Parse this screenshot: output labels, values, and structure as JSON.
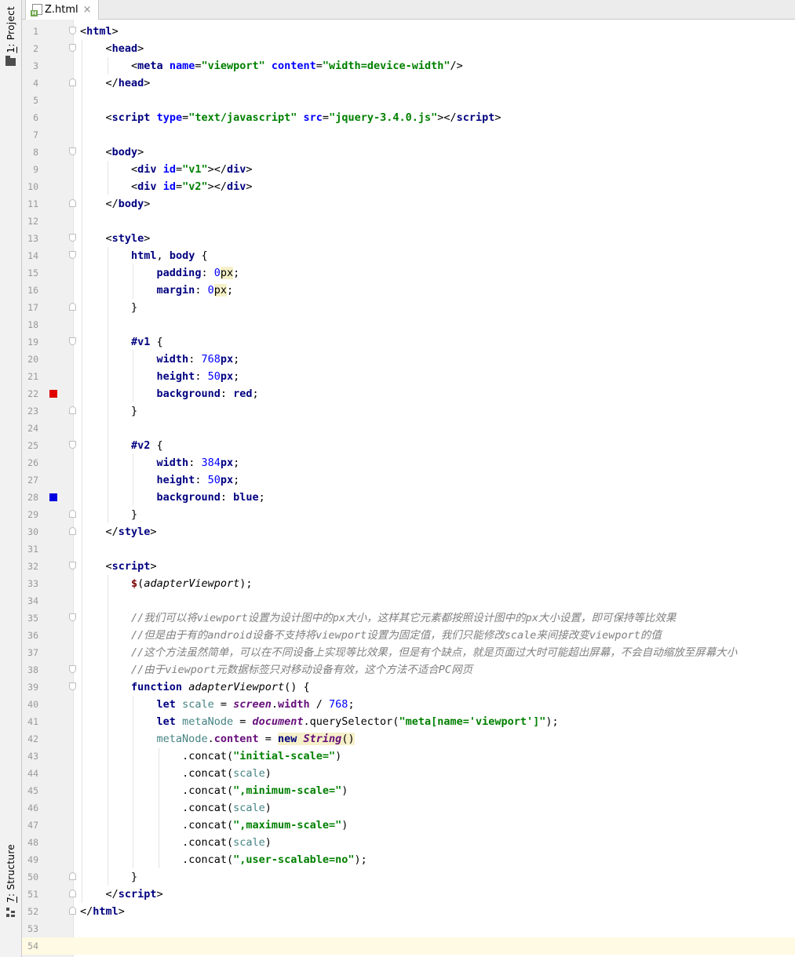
{
  "tool_window": {
    "project_label_num": "1",
    "project_label_text": ": Project",
    "structure_label_num": "7",
    "structure_label_text": ": Structure"
  },
  "editor_tab": {
    "filename": "Z.html",
    "icon_badge": "H",
    "close_glyph": "×"
  },
  "markers": {
    "line_22_color": "#e00000",
    "line_28_color": "#0000e0"
  },
  "lines": [
    {
      "n": "1"
    },
    {
      "n": "2"
    },
    {
      "n": "3"
    },
    {
      "n": "4"
    },
    {
      "n": "5"
    },
    {
      "n": "6"
    },
    {
      "n": "7"
    },
    {
      "n": "8"
    },
    {
      "n": "9"
    },
    {
      "n": "10"
    },
    {
      "n": "11"
    },
    {
      "n": "12"
    },
    {
      "n": "13"
    },
    {
      "n": "14"
    },
    {
      "n": "15"
    },
    {
      "n": "16"
    },
    {
      "n": "17"
    },
    {
      "n": "18"
    },
    {
      "n": "19"
    },
    {
      "n": "20"
    },
    {
      "n": "21"
    },
    {
      "n": "22"
    },
    {
      "n": "23"
    },
    {
      "n": "24"
    },
    {
      "n": "25"
    },
    {
      "n": "26"
    },
    {
      "n": "27"
    },
    {
      "n": "28"
    },
    {
      "n": "29"
    },
    {
      "n": "30"
    },
    {
      "n": "31"
    },
    {
      "n": "32"
    },
    {
      "n": "33"
    },
    {
      "n": "34"
    },
    {
      "n": "35"
    },
    {
      "n": "36"
    },
    {
      "n": "37"
    },
    {
      "n": "38"
    },
    {
      "n": "39"
    },
    {
      "n": "40"
    },
    {
      "n": "41"
    },
    {
      "n": "42"
    },
    {
      "n": "43"
    },
    {
      "n": "44"
    },
    {
      "n": "45"
    },
    {
      "n": "46"
    },
    {
      "n": "47"
    },
    {
      "n": "48"
    },
    {
      "n": "49"
    },
    {
      "n": "50"
    },
    {
      "n": "51"
    },
    {
      "n": "52"
    },
    {
      "n": "53"
    },
    {
      "n": "54"
    }
  ],
  "code": {
    "l1": [
      {
        "c": "p",
        "t": "<"
      },
      {
        "c": "t",
        "t": "html"
      },
      {
        "c": "p",
        "t": ">"
      }
    ],
    "l2": [
      {
        "c": "p",
        "t": "<"
      },
      {
        "c": "t",
        "t": "head"
      },
      {
        "c": "p",
        "t": ">"
      }
    ],
    "l3": [
      {
        "c": "p",
        "t": "<"
      },
      {
        "c": "t",
        "t": "meta "
      },
      {
        "c": "a",
        "t": "name"
      },
      {
        "c": "p",
        "t": "="
      },
      {
        "c": "s",
        "t": "\"viewport\" "
      },
      {
        "c": "a",
        "t": "content"
      },
      {
        "c": "p",
        "t": "="
      },
      {
        "c": "s",
        "t": "\"width=device-width\""
      },
      {
        "c": "p",
        "t": "/>"
      }
    ],
    "l4": [
      {
        "c": "p",
        "t": "</"
      },
      {
        "c": "t",
        "t": "head"
      },
      {
        "c": "p",
        "t": ">"
      }
    ],
    "l6": [
      {
        "c": "p",
        "t": "<"
      },
      {
        "c": "t",
        "t": "script "
      },
      {
        "c": "a",
        "t": "type"
      },
      {
        "c": "p",
        "t": "="
      },
      {
        "c": "s",
        "t": "\"text/javascript\" "
      },
      {
        "c": "a",
        "t": "src"
      },
      {
        "c": "p",
        "t": "="
      },
      {
        "c": "s",
        "t": "\"jquery-3.4.0.js\""
      },
      {
        "c": "p",
        "t": "></"
      },
      {
        "c": "t",
        "t": "script"
      },
      {
        "c": "p",
        "t": ">"
      }
    ],
    "l8": [
      {
        "c": "p",
        "t": "<"
      },
      {
        "c": "t",
        "t": "body"
      },
      {
        "c": "p",
        "t": ">"
      }
    ],
    "l9": [
      {
        "c": "p",
        "t": "<"
      },
      {
        "c": "t",
        "t": "div "
      },
      {
        "c": "a",
        "t": "id"
      },
      {
        "c": "p",
        "t": "="
      },
      {
        "c": "s",
        "t": "\"v1\""
      },
      {
        "c": "p",
        "t": "></"
      },
      {
        "c": "t",
        "t": "div"
      },
      {
        "c": "p",
        "t": ">"
      }
    ],
    "l10": [
      {
        "c": "p",
        "t": "<"
      },
      {
        "c": "t",
        "t": "div "
      },
      {
        "c": "a",
        "t": "id"
      },
      {
        "c": "p",
        "t": "="
      },
      {
        "c": "s",
        "t": "\"v2\""
      },
      {
        "c": "p",
        "t": "></"
      },
      {
        "c": "t",
        "t": "div"
      },
      {
        "c": "p",
        "t": ">"
      }
    ],
    "l11": [
      {
        "c": "p",
        "t": "</"
      },
      {
        "c": "t",
        "t": "body"
      },
      {
        "c": "p",
        "t": ">"
      }
    ],
    "l13": [
      {
        "c": "p",
        "t": "<"
      },
      {
        "c": "t",
        "t": "style"
      },
      {
        "c": "p",
        "t": ">"
      }
    ],
    "l14": [
      {
        "c": "t",
        "t": "html"
      },
      {
        "c": "p",
        "t": ", "
      },
      {
        "c": "t",
        "t": "body "
      },
      {
        "c": "p",
        "t": "{"
      }
    ],
    "l15": [
      {
        "c": "pr",
        "t": "padding"
      },
      {
        "c": "p",
        "t": ": "
      },
      {
        "c": "n",
        "t": "0"
      },
      {
        "c": "px",
        "t": "px"
      },
      {
        "c": "p",
        "t": ";"
      }
    ],
    "l16": [
      {
        "c": "pr",
        "t": "margin"
      },
      {
        "c": "p",
        "t": ": "
      },
      {
        "c": "n",
        "t": "0"
      },
      {
        "c": "px",
        "t": "px"
      },
      {
        "c": "p",
        "t": ";"
      }
    ],
    "l17": [
      {
        "c": "p",
        "t": "}"
      }
    ],
    "l19": [
      {
        "c": "t",
        "t": "#v1 "
      },
      {
        "c": "p",
        "t": "{"
      }
    ],
    "l20": [
      {
        "c": "pr",
        "t": "width"
      },
      {
        "c": "p",
        "t": ": "
      },
      {
        "c": "n",
        "t": "768"
      },
      {
        "c": "pr",
        "t": "px"
      },
      {
        "c": "p",
        "t": ";"
      }
    ],
    "l21": [
      {
        "c": "pr",
        "t": "height"
      },
      {
        "c": "p",
        "t": ": "
      },
      {
        "c": "n",
        "t": "50"
      },
      {
        "c": "pr",
        "t": "px"
      },
      {
        "c": "p",
        "t": ";"
      }
    ],
    "l22": [
      {
        "c": "pr",
        "t": "background"
      },
      {
        "c": "p",
        "t": ": "
      },
      {
        "c": "pr",
        "t": "red"
      },
      {
        "c": "p",
        "t": ";"
      }
    ],
    "l23": [
      {
        "c": "p",
        "t": "}"
      }
    ],
    "l25": [
      {
        "c": "t",
        "t": "#v2 "
      },
      {
        "c": "p",
        "t": "{"
      }
    ],
    "l26": [
      {
        "c": "pr",
        "t": "width"
      },
      {
        "c": "p",
        "t": ": "
      },
      {
        "c": "n",
        "t": "384"
      },
      {
        "c": "pr",
        "t": "px"
      },
      {
        "c": "p",
        "t": ";"
      }
    ],
    "l27": [
      {
        "c": "pr",
        "t": "height"
      },
      {
        "c": "p",
        "t": ": "
      },
      {
        "c": "n",
        "t": "50"
      },
      {
        "c": "pr",
        "t": "px"
      },
      {
        "c": "p",
        "t": ";"
      }
    ],
    "l28": [
      {
        "c": "pr",
        "t": "background"
      },
      {
        "c": "p",
        "t": ": "
      },
      {
        "c": "pr",
        "t": "blue"
      },
      {
        "c": "p",
        "t": ";"
      }
    ],
    "l29": [
      {
        "c": "p",
        "t": "}"
      }
    ],
    "l30": [
      {
        "c": "p",
        "t": "</"
      },
      {
        "c": "t",
        "t": "style"
      },
      {
        "c": "p",
        "t": ">"
      }
    ],
    "l32": [
      {
        "c": "p",
        "t": "<"
      },
      {
        "c": "t",
        "t": "script"
      },
      {
        "c": "p",
        "t": ">"
      }
    ],
    "l33": [
      {
        "c": "jq",
        "t": "$"
      },
      {
        "c": "p",
        "t": "("
      },
      {
        "c": "fn",
        "t": "adapterViewport"
      },
      {
        "c": "p",
        "t": ");"
      }
    ],
    "l35": [
      {
        "c": "c",
        "t": "//我们可以将viewport设置为设计图中的px大小，这样其它元素都按照设计图中的px大小设置，即可保持等比效果"
      }
    ],
    "l36": [
      {
        "c": "c",
        "t": "//但是由于有的android设备不支持将viewport设置为固定值，我们只能修改scale来间接改变viewport的值"
      }
    ],
    "l37": [
      {
        "c": "c",
        "t": "//这个方法虽然简单，可以在不同设备上实现等比效果，但是有个缺点，就是页面过大时可能超出屏幕，不会自动缩放至屏幕大小"
      }
    ],
    "l38": [
      {
        "c": "c",
        "t": "//由于viewport元数据标签只对移动设备有效，这个方法不适合PC网页"
      }
    ],
    "l39": [
      {
        "c": "k",
        "t": "function "
      },
      {
        "c": "fn",
        "t": "adapterViewport"
      },
      {
        "c": "p",
        "t": "() {"
      }
    ],
    "l40": [
      {
        "c": "k",
        "t": "let "
      },
      {
        "c": "v",
        "t": "scale"
      },
      {
        "c": "p",
        "t": " = "
      },
      {
        "c": "gl",
        "t": "screen"
      },
      {
        "c": "p",
        "t": "."
      },
      {
        "c": "mem",
        "t": "width"
      },
      {
        "c": "p",
        "t": " / "
      },
      {
        "c": "n",
        "t": "768"
      },
      {
        "c": "p",
        "t": ";"
      }
    ],
    "l41": [
      {
        "c": "k",
        "t": "let "
      },
      {
        "c": "v",
        "t": "metaNode"
      },
      {
        "c": "p",
        "t": " = "
      },
      {
        "c": "gl",
        "t": "document"
      },
      {
        "c": "p",
        "t": ".querySelector("
      },
      {
        "c": "s",
        "t": "\"meta[name='viewport']\""
      },
      {
        "c": "p",
        "t": ");"
      }
    ],
    "l42": [
      {
        "c": "v",
        "t": "metaNode"
      },
      {
        "c": "p",
        "t": "."
      },
      {
        "c": "mem",
        "t": "content"
      },
      {
        "c": "p",
        "t": " = "
      },
      {
        "c": "hk",
        "t": "new "
      },
      {
        "c": "hs",
        "t": "String"
      },
      {
        "c": "hp",
        "t": "()"
      }
    ],
    "l43": [
      {
        "c": "p",
        "t": ".concat("
      },
      {
        "c": "s",
        "t": "\"initial-scale=\""
      },
      {
        "c": "p",
        "t": ")"
      }
    ],
    "l44": [
      {
        "c": "p",
        "t": ".concat("
      },
      {
        "c": "v",
        "t": "scale"
      },
      {
        "c": "p",
        "t": ")"
      }
    ],
    "l45": [
      {
        "c": "p",
        "t": ".concat("
      },
      {
        "c": "s",
        "t": "\",minimum-scale=\""
      },
      {
        "c": "p",
        "t": ")"
      }
    ],
    "l46": [
      {
        "c": "p",
        "t": ".concat("
      },
      {
        "c": "v",
        "t": "scale"
      },
      {
        "c": "p",
        "t": ")"
      }
    ],
    "l47": [
      {
        "c": "p",
        "t": ".concat("
      },
      {
        "c": "s",
        "t": "\",maximum-scale=\""
      },
      {
        "c": "p",
        "t": ")"
      }
    ],
    "l48": [
      {
        "c": "p",
        "t": ".concat("
      },
      {
        "c": "v",
        "t": "scale"
      },
      {
        "c": "p",
        "t": ")"
      }
    ],
    "l49": [
      {
        "c": "p",
        "t": ".concat("
      },
      {
        "c": "s",
        "t": "\",user-scalable=no\""
      },
      {
        "c": "p",
        "t": ");"
      }
    ],
    "l50": [
      {
        "c": "p",
        "t": "}"
      }
    ],
    "l51": [
      {
        "c": "p",
        "t": "</"
      },
      {
        "c": "t",
        "t": "script"
      },
      {
        "c": "p",
        "t": ">"
      }
    ],
    "l52": [
      {
        "c": "p",
        "t": "</"
      },
      {
        "c": "t",
        "t": "html"
      },
      {
        "c": "p",
        "t": ">"
      }
    ]
  }
}
